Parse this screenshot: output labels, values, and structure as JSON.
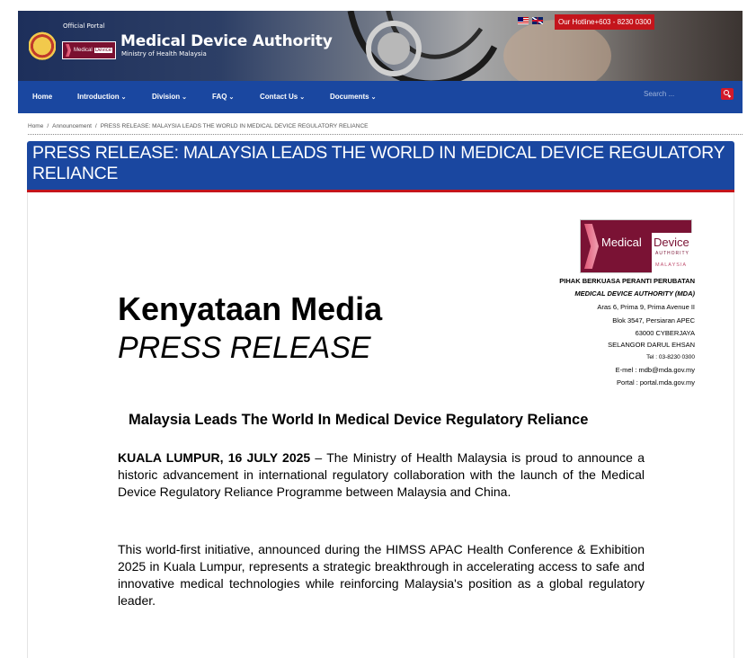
{
  "header": {
    "official_label": "Official Portal",
    "logo_word_medical": "Medical",
    "logo_word_device": "Device",
    "site_title": "Medical Device Authority",
    "site_subtitle": "Ministry of Health Malaysia",
    "flags": [
      "malaysia-flag-icon",
      "uk-flag-icon"
    ],
    "hotline": "Our Hotline+603 - 8230 0300"
  },
  "nav": {
    "items": [
      {
        "label": "Home",
        "has_dropdown": false
      },
      {
        "label": "Introduction",
        "has_dropdown": true
      },
      {
        "label": "Division",
        "has_dropdown": true
      },
      {
        "label": "FAQ",
        "has_dropdown": true
      },
      {
        "label": "Contact Us",
        "has_dropdown": true
      },
      {
        "label": "Documents",
        "has_dropdown": true
      }
    ],
    "search_placeholder": "Search ...",
    "search_icon": "search-icon",
    "chevron": "⌄"
  },
  "breadcrumb": {
    "items": [
      "Home",
      "Announcement",
      "PRESS RELEASE: MALAYSIA LEADS THE WORLD IN MEDICAL DEVICE REGULATORY RELIANCE"
    ],
    "separator": "/"
  },
  "page": {
    "title": "PRESS RELEASE: MALAYSIA LEADS THE WORLD IN MEDICAL DEVICE REGULATORY RELIANCE"
  },
  "document": {
    "logo": {
      "medical": "Medical",
      "device": "Device",
      "authority": "AUTHORITY",
      "malaysia": "MALAYSIA"
    },
    "address": {
      "org_malay": "PIHAK BERKUASA PERANTI PERUBATAN",
      "org_english": "MEDICAL DEVICE AUTHORITY (MDA)",
      "line1": "Aras 6, Prima 9, Prima Avenue II",
      "line2": "Blok 3547, Persiaran APEC",
      "line3": "63000 CYBERJAYA",
      "line4": "SELANGOR DARUL EHSAN",
      "tel": "Tel : 03-8230 0300",
      "email": "E-mel : mdb@mda.gov.my",
      "portal": "Portal : portal.mda.gov.my"
    },
    "heading_malay": "Kenyataan Media",
    "heading_english": "PRESS RELEASE",
    "headline": "Malaysia Leads The World In Medical Device Regulatory Reliance",
    "dateline": "KUALA LUMPUR, 16 JULY 2025",
    "paragraph1_rest": " – The Ministry of Health Malaysia is proud to announce a historic advancement in international regulatory collaboration with the launch of the Medical Device Regulatory Reliance Programme between Malaysia and China.",
    "paragraph2": "This world-first initiative, announced during the HIMSS APAC Health Conference & Exhibition 2025 in Kuala Lumpur, represents a strategic breakthrough in accelerating access to safe and innovative medical technologies while reinforcing Malaysia's position as a global regulatory leader."
  },
  "colors": {
    "nav_blue": "#1a47a0",
    "accent_red": "#c4151c",
    "mda_maroon": "#7a1234"
  }
}
